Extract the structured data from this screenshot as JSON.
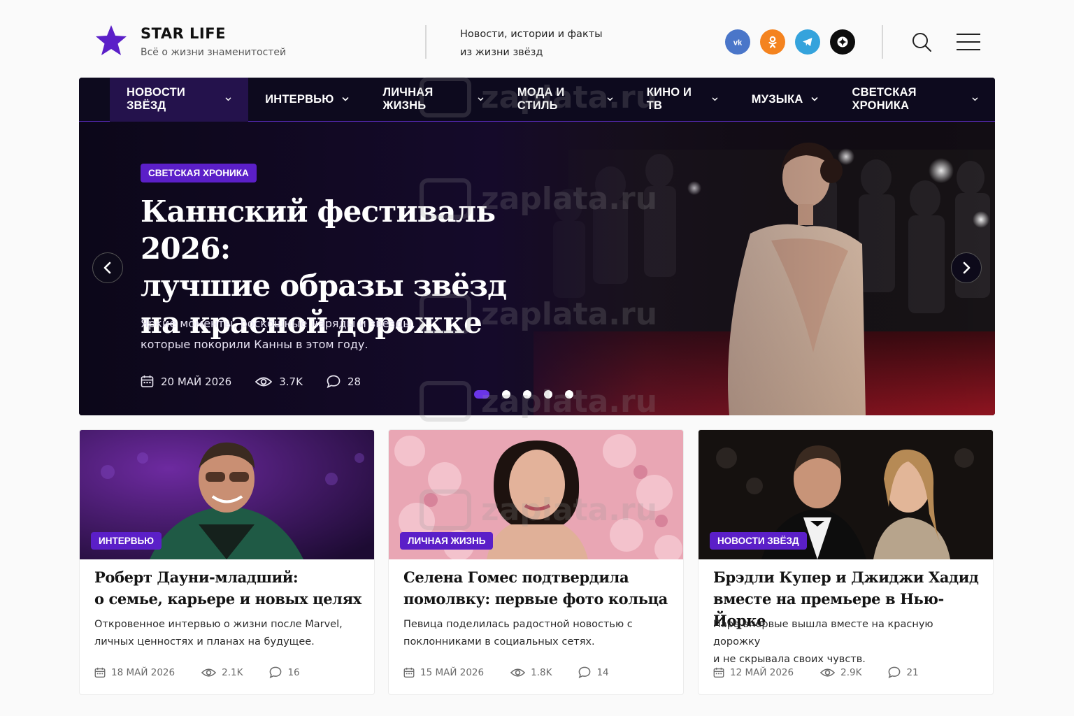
{
  "brand": {
    "name": "STAR LIFE",
    "tagline": "Всё о жизни знаменитостей",
    "accent": "#5b1fc8"
  },
  "header": {
    "description_line1": "Новости, истории и факты",
    "description_line2": "из жизни звёзд",
    "socials": [
      {
        "icon": "vk-icon",
        "color": "#4a76c9"
      },
      {
        "icon": "odnoklassniki-icon",
        "color": "#f4831f"
      },
      {
        "icon": "telegram-icon",
        "color": "#35a3dc"
      },
      {
        "icon": "dzen-icon",
        "color": "#0d0d0d"
      }
    ]
  },
  "nav": {
    "items": [
      {
        "label": "НОВОСТИ ЗВЁЗД",
        "active": true
      },
      {
        "label": "ИНТЕРВЬЮ"
      },
      {
        "label": "ЛИЧНАЯ ЖИЗНЬ"
      },
      {
        "label": "МОДА И СТИЛЬ"
      },
      {
        "label": "КИНО И ТВ"
      },
      {
        "label": "МУЗЫКА"
      },
      {
        "label": "СВЕТСКАЯ ХРОНИКА"
      }
    ]
  },
  "hero": {
    "badge": "СВЕТСКАЯ ХРОНИКА",
    "title_line1": "Каннский фестиваль 2026:",
    "title_line2": "лучшие образы звёзд",
    "title_line3": "на красной дорожке",
    "subtitle_line1": "Яркие моменты, роскошные наряды и звёзды,",
    "subtitle_line2": "которые покорили Канны в этом году.",
    "date": "20 МАЙ 2026",
    "views": "3.7K",
    "comments": "28",
    "slides_total": 5,
    "slide_active": 1
  },
  "cards": [
    {
      "badge": "ИНТЕРВЬЮ",
      "title_line1": "Роберт Дауни-младший:",
      "title_line2": "о семье, карьере и новых целях",
      "desc_line1": "Откровенное интервью о жизни после Marvel,",
      "desc_line2": "личных ценностях и планах на будущее.",
      "date": "18 МАЙ 2026",
      "views": "2.1K",
      "comments": "16"
    },
    {
      "badge": "ЛИЧНАЯ ЖИЗНЬ",
      "title_line1": "Селена Гомес подтвердила",
      "title_line2": "помолвку: первые фото кольца",
      "desc_line1": "Певица поделилась радостной новостью с",
      "desc_line2": "поклонниками в социальных сетях.",
      "date": "15 МАЙ 2026",
      "views": "1.8K",
      "comments": "14"
    },
    {
      "badge": "НОВОСТИ ЗВЁЗД",
      "title_line1": "Брэдли Купер и Джиджи Хадид",
      "title_line2": "вместе на премьере в Нью-Йорке",
      "desc_line1": "Пара впервые вышла вместе на красную дорожку",
      "desc_line2": "и не скрывала своих чувств.",
      "date": "12 МАЙ 2026",
      "views": "2.9K",
      "comments": "21"
    }
  ],
  "watermark": {
    "text": "zaplata.ru"
  }
}
